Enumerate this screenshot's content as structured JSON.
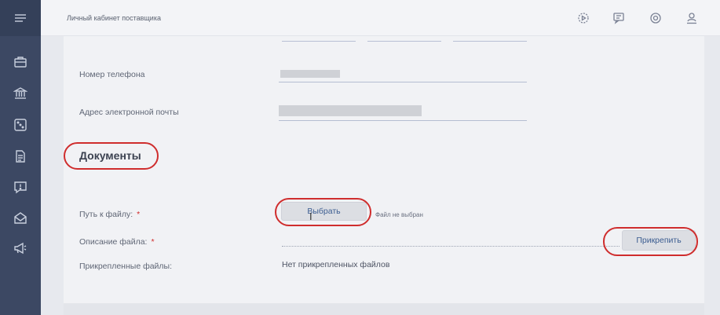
{
  "header": {
    "title": "Личный кабинет поставщика",
    "icons": [
      "play-circle-icon",
      "feedback-icon",
      "settings-icon",
      "user-icon"
    ]
  },
  "sidebar": {
    "menu_icon": "burger-menu-icon",
    "items": [
      "briefcase-icon",
      "bank-icon",
      "dice-icon",
      "document-icon",
      "alert-message-icon",
      "envelope-icon",
      "megaphone-icon"
    ]
  },
  "form": {
    "phone_label": "Номер телефона",
    "email_label": "Адрес электронной почты",
    "documents_title": "Документы",
    "file_path_label": "Путь к файлу:",
    "required_mark": "*",
    "choose_button": "Выбрать",
    "no_file_selected": "Файл не выбран",
    "file_description_label": "Описание файла:",
    "attach_button": "Прикрепить",
    "attached_files_label": "Прикрепленные файлы:",
    "no_attached_files": "Нет прикрепленных файлов"
  },
  "colors": {
    "sidebar": "#3c4863",
    "highlight": "#cf2d2d",
    "required": "#d02a2a",
    "button_text": "#3c5d91"
  }
}
